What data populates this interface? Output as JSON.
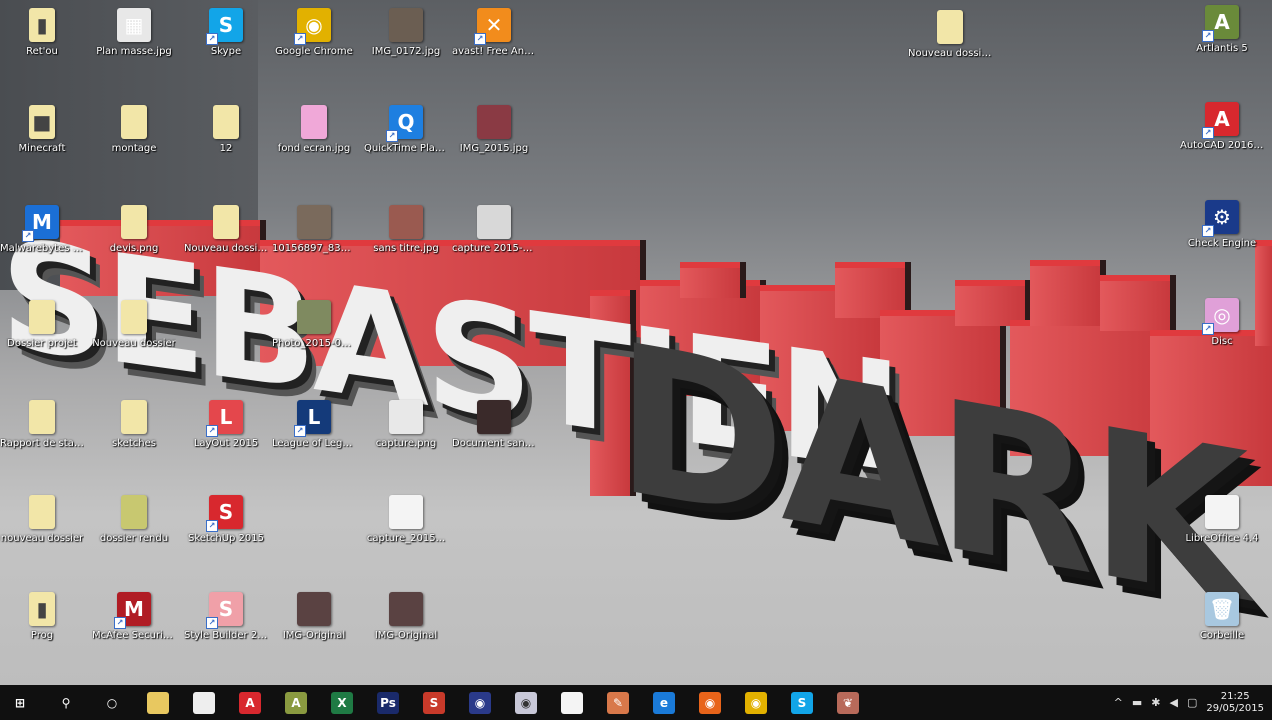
{
  "wallpaper": {
    "text_1": "SEBASTIEN",
    "text_2": "DARK",
    "accent": "#d9383c"
  },
  "desktop_icons": [
    {
      "label": "Ret'ou",
      "kind": "folder",
      "color": "#f2e6a8",
      "glyph": "▮",
      "shortcut": false
    },
    {
      "label": "Plan masse.jpg",
      "kind": "image",
      "color": "#e8e8e8",
      "glyph": "▦",
      "shortcut": false
    },
    {
      "label": "Skype",
      "kind": "app",
      "color": "#12a5e8",
      "glyph": "S",
      "shortcut": true
    },
    {
      "label": "Google Chrome",
      "kind": "app",
      "color": "#e2b100",
      "glyph": "◉",
      "shortcut": true
    },
    {
      "label": "IMG_0172.jpg",
      "kind": "image",
      "color": "#6b5e52",
      "glyph": "",
      "shortcut": false
    },
    {
      "label": "avast! Free Antivirus",
      "kind": "app",
      "color": "#f28c1c",
      "glyph": "✕",
      "shortcut": true
    },
    {
      "label": "Minecraft",
      "kind": "folder",
      "color": "#f2e6a8",
      "glyph": "■",
      "shortcut": false
    },
    {
      "label": "montage",
      "kind": "folder",
      "color": "#f2e6a8",
      "glyph": "",
      "shortcut": false
    },
    {
      "label": "12",
      "kind": "folder",
      "color": "#f2e6a8",
      "glyph": "",
      "shortcut": false
    },
    {
      "label": "fond ecran.jpg",
      "kind": "folder",
      "color": "#f0a8d8",
      "glyph": "",
      "shortcut": false
    },
    {
      "label": "QuickTime Player",
      "kind": "app",
      "color": "#1e7fe0",
      "glyph": "Q",
      "shortcut": true
    },
    {
      "label": "IMG_2015.jpg",
      "kind": "image",
      "color": "#8a3a44",
      "glyph": "",
      "shortcut": false
    },
    {
      "label": "Malwarebytes Anti-Malware",
      "kind": "app",
      "color": "#1b6fd6",
      "glyph": "M",
      "shortcut": true
    },
    {
      "label": "devis.png",
      "kind": "folder",
      "color": "#f2e6a8",
      "glyph": "",
      "shortcut": false
    },
    {
      "label": "Nouveau dossier (2)",
      "kind": "folder",
      "color": "#f2e6a8",
      "glyph": "",
      "shortcut": false
    },
    {
      "label": "10156897_8372...",
      "kind": "image",
      "color": "#7a6a5c",
      "glyph": "",
      "shortcut": false
    },
    {
      "label": "sans titre.jpg",
      "kind": "image",
      "color": "#9a5a50",
      "glyph": "",
      "shortcut": false
    },
    {
      "label": "capture 2015-05...",
      "kind": "image",
      "color": "#d8d8d8",
      "glyph": "",
      "shortcut": false
    },
    {
      "label": "Dossier projet",
      "kind": "folder",
      "color": "#f2e6a8",
      "glyph": "",
      "shortcut": false
    },
    {
      "label": "Nouveau dossier",
      "kind": "folder",
      "color": "#f2e6a8",
      "glyph": "",
      "shortcut": false
    },
    {
      "label": "Photo_2015-05-26 at 20.16...",
      "kind": "image",
      "color": "#7f8a60",
      "glyph": "",
      "shortcut": false
    },
    {
      "label": "Rapport de stage",
      "kind": "folder",
      "color": "#f2e6a8",
      "glyph": "",
      "shortcut": false
    },
    {
      "label": "sketches",
      "kind": "folder",
      "color": "#f2e6a8",
      "glyph": "",
      "shortcut": false
    },
    {
      "label": "LayOut 2015",
      "kind": "app",
      "color": "#e4474c",
      "glyph": "L",
      "shortcut": true
    },
    {
      "label": "League of Legends",
      "kind": "app",
      "color": "#143a7a",
      "glyph": "L",
      "shortcut": true
    },
    {
      "label": "capture.png",
      "kind": "image",
      "color": "#e8e8e8",
      "glyph": "",
      "shortcut": false
    },
    {
      "label": "Document sans titre",
      "kind": "image",
      "color": "#3a2a2a",
      "glyph": "",
      "shortcut": false
    },
    {
      "label": "nouveau dossier",
      "kind": "folder",
      "color": "#f2e6a8",
      "glyph": "",
      "shortcut": false
    },
    {
      "label": "dossier rendu",
      "kind": "folder",
      "color": "#c8c870",
      "glyph": "",
      "shortcut": false
    },
    {
      "label": "SketchUp 2015",
      "kind": "app",
      "color": "#d8282e",
      "glyph": "S",
      "shortcut": true
    },
    {
      "label": "capture_2015...",
      "kind": "image",
      "color": "#f4f4f4",
      "glyph": "",
      "shortcut": false
    },
    {
      "label": "Prog",
      "kind": "folder",
      "color": "#f2e6a8",
      "glyph": "▮",
      "shortcut": false
    },
    {
      "label": "McAfee Security Scan Plus",
      "kind": "app",
      "color": "#b01c24",
      "glyph": "M",
      "shortcut": true
    },
    {
      "label": "Style Builder 2015",
      "kind": "app",
      "color": "#f0a0a8",
      "glyph": "S",
      "shortcut": true
    },
    {
      "label": "IMG-Original",
      "kind": "image",
      "color": "#5a4242",
      "glyph": "",
      "shortcut": false
    },
    {
      "label": "IMG-Original",
      "kind": "image",
      "color": "#5a4242",
      "glyph": "",
      "shortcut": false
    },
    {
      "label": "Nouveau dossier (3)",
      "kind": "folder",
      "color": "#f2e6a8",
      "glyph": "",
      "shortcut": false
    },
    {
      "label": "Artlantis 5",
      "kind": "app",
      "color": "#6a8a3a",
      "glyph": "A",
      "shortcut": true
    },
    {
      "label": "AutoCAD 2016 - Français",
      "kind": "app",
      "color": "#d8282e",
      "glyph": "A",
      "shortcut": true
    },
    {
      "label": "Check Engine",
      "kind": "app",
      "color": "#1a3a8a",
      "glyph": "⚙",
      "shortcut": true
    },
    {
      "label": "Disc",
      "kind": "app",
      "color": "#e0a0d8",
      "glyph": "◎",
      "shortcut": true
    },
    {
      "label": "LibreOffice 4.4",
      "kind": "file",
      "color": "#f4f4f4",
      "glyph": "",
      "shortcut": false
    },
    {
      "label": "Corbeille",
      "kind": "recycle-bin",
      "color": "#a8c8e0",
      "glyph": "🗑",
      "shortcut": false
    }
  ],
  "taskbar": {
    "items": [
      {
        "name": "start",
        "color": "#101010",
        "glyph": "⊞"
      },
      {
        "name": "search",
        "color": "#101010",
        "glyph": "⚲"
      },
      {
        "name": "task-view",
        "color": "#101010",
        "glyph": "○"
      },
      {
        "name": "file-explorer",
        "color": "#e8c860",
        "glyph": ""
      },
      {
        "name": "store",
        "color": "#eeeeee",
        "glyph": ""
      },
      {
        "name": "acrobat",
        "color": "#d8282e",
        "glyph": "A"
      },
      {
        "name": "artlantis",
        "color": "#8a9a40",
        "glyph": "A"
      },
      {
        "name": "excel",
        "color": "#1f7a44",
        "glyph": "X"
      },
      {
        "name": "photoshop",
        "color": "#1a2a6a",
        "glyph": "Ps"
      },
      {
        "name": "app-red-green",
        "color": "#c83a2a",
        "glyph": "S"
      },
      {
        "name": "app-circle-blue",
        "color": "#2a3a8a",
        "glyph": "◉"
      },
      {
        "name": "app-circle-grey",
        "color": "#c8c8d8",
        "glyph": "◉"
      },
      {
        "name": "document",
        "color": "#f4f4f4",
        "glyph": ""
      },
      {
        "name": "app-orange",
        "color": "#d8784a",
        "glyph": "✎"
      },
      {
        "name": "edge",
        "color": "#1a7ad8",
        "glyph": "e"
      },
      {
        "name": "firefox",
        "color": "#e8641a",
        "glyph": "◉"
      },
      {
        "name": "chrome",
        "color": "#e2b100",
        "glyph": "◉"
      },
      {
        "name": "skype",
        "color": "#12a5e8",
        "glyph": "S"
      },
      {
        "name": "app-misc",
        "color": "#b86a5a",
        "glyph": "❦"
      }
    ],
    "tray": {
      "chevron": "^",
      "battery": "▬",
      "network": "✱",
      "volume": "◀",
      "notifications": "▢",
      "time": "21:25",
      "date": "29/05/2015"
    }
  }
}
